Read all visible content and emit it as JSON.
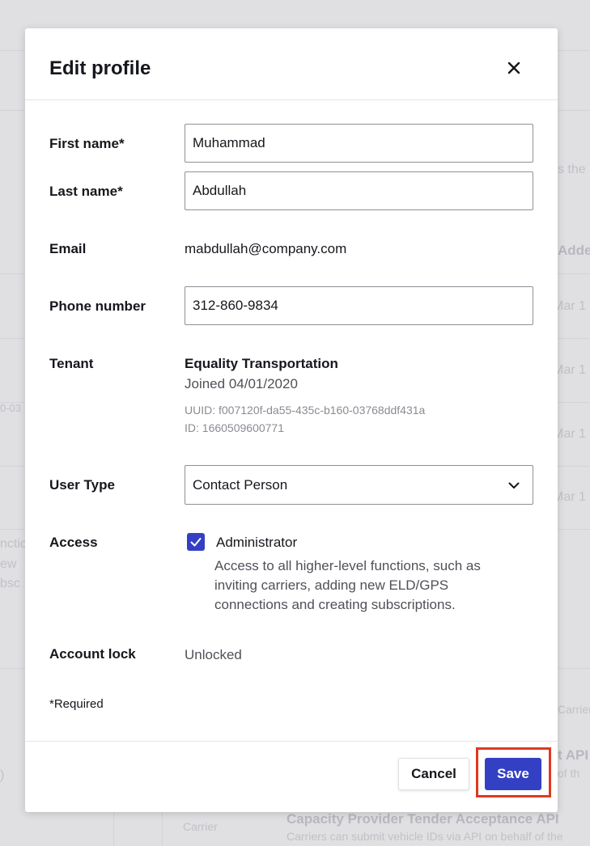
{
  "background": {
    "right_fragments": [
      "s the",
      "Adde",
      "Mar 1",
      "Mar 1",
      "Mar 1",
      "Mar 1",
      "Carrier",
      "t API",
      "of th"
    ],
    "left_fragments": [
      "0-03",
      "nctio",
      "ew",
      "bsc",
      ")"
    ],
    "bottom_tag": "Carrier",
    "bottom_title": "Capacity Provider Tender Acceptance API",
    "bottom_desc": "Carriers can submit vehicle IDs via API on behalf of the"
  },
  "modal": {
    "title": "Edit profile",
    "close_icon": "close-icon",
    "fields": {
      "first_name": {
        "label": "First name*",
        "value": "Muhammad"
      },
      "last_name": {
        "label": "Last name*",
        "value": "Abdullah"
      },
      "email": {
        "label": "Email",
        "value": "mabdullah@company.com"
      },
      "phone": {
        "label": "Phone number",
        "value": "312-860-9834"
      },
      "tenant": {
        "label": "Tenant",
        "name": "Equality Transportation",
        "joined": "Joined 04/01/2020",
        "uuid": "UUID: f007120f-da55-435c-b160-03768ddf431a",
        "id": "ID: 1660509600771"
      },
      "user_type": {
        "label": "User Type",
        "value": "Contact Person",
        "icon": "chevron-down-icon"
      },
      "access": {
        "label": "Access",
        "option": "Administrator",
        "checked": true,
        "description": "Access to all higher-level functions, such as inviting carriers, adding new ELD/GPS connections and creating subscriptions."
      },
      "account_lock": {
        "label": "Account lock",
        "value": "Unlocked"
      }
    },
    "required_note": "*Required",
    "footer": {
      "cancel_label": "Cancel",
      "save_label": "Save"
    }
  },
  "colors": {
    "primary": "#3440c4",
    "highlight": "#e0391f"
  }
}
